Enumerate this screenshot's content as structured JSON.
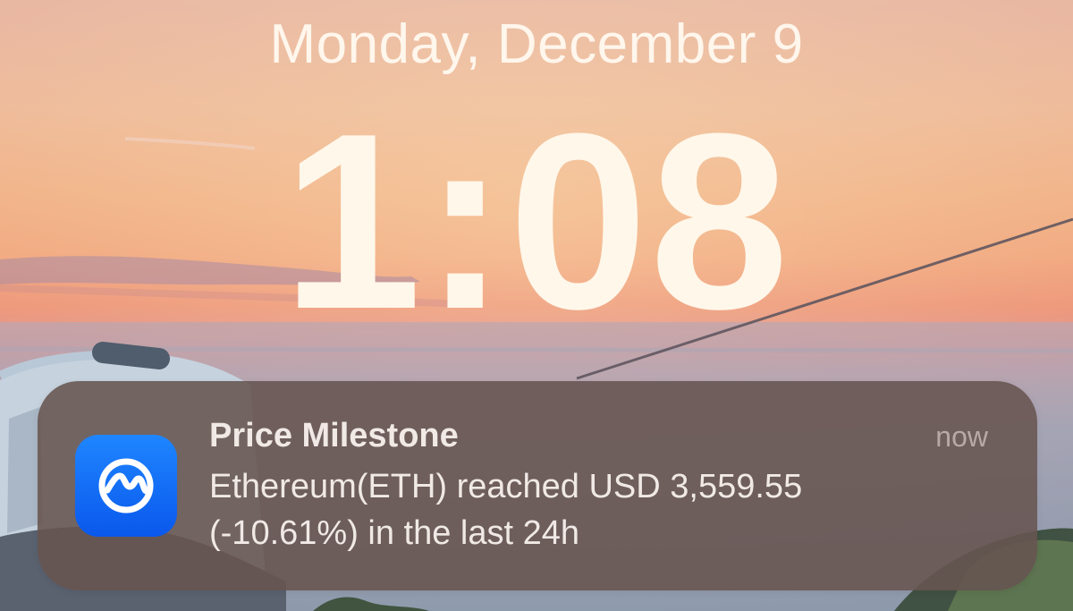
{
  "lockscreen": {
    "date": "Monday, December 9",
    "time": "1:08",
    "wallpaper_icon": "sunset-photo"
  },
  "notification": {
    "app_icon": "coinmarketcap-icon",
    "title": "Price Milestone",
    "time": "now",
    "body_line1": "Ethereum(ETH) reached USD 3,559.55",
    "body_line2": "(-10.61%) in the last 24h"
  },
  "colors": {
    "sky_top": "#e7b3a0",
    "sky_middle": "#f0a27a",
    "sky_bottom": "#9aa2b6",
    "notification_bg": "#675450",
    "app_icon_blue": "#1f86ff"
  }
}
